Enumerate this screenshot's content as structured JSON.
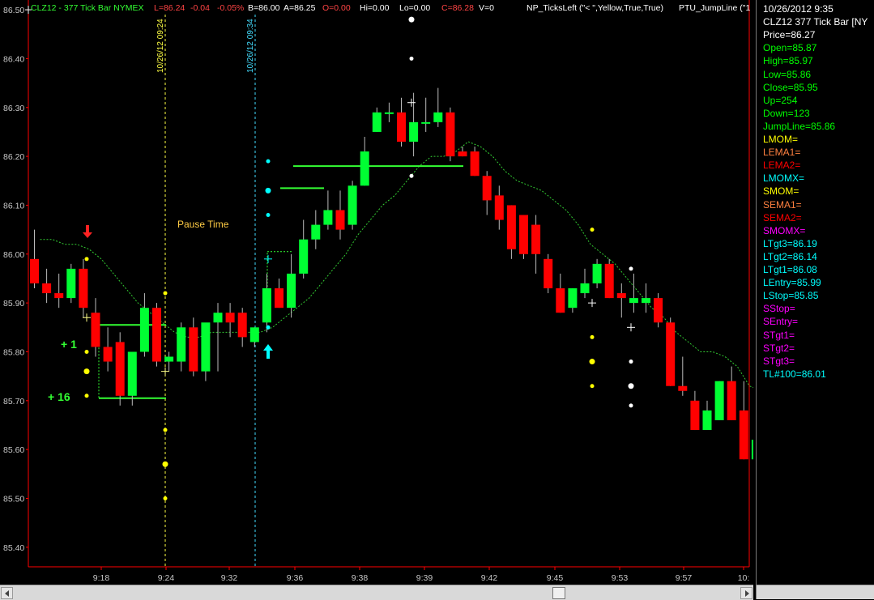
{
  "header": {
    "symbol": "CLZ12 - 377 Tick Bar  NYMEX",
    "last": "L=86.24",
    "change": "-0.04",
    "pct": "-0.05%",
    "bid": "B=86.00",
    "ask": "A=86.25",
    "open": "O=0.00",
    "hi": "Hi=0.00",
    "lo": "Lo=0.00",
    "close": "C=86.28",
    "volume": "V=0",
    "indicator1": "NP_TicksLeft (\"< \",Yellow,True,True)",
    "indicator2": "PTU_JumpLine (\"1"
  },
  "colors": {
    "up": "#00ff33",
    "down": "#ff0000",
    "axis": "#ff0000",
    "label_green": "#00ff00",
    "label_yellow": "#ffff00",
    "label_cyan": "#00ffff",
    "label_magenta": "#ff00ff",
    "label_orange": "#ff8040",
    "label_white": "#ffffff",
    "pause_text": "#ffcc44"
  },
  "annotations": {
    "pause_time": "Pause Time",
    "plus_one": "+ 1",
    "plus_sixteen": "+ 16",
    "vline1_label": "10/26/12 09:24",
    "vline2_label": "10/26/12 09:34"
  },
  "chart_data": {
    "type": "candlestick",
    "ylim": [
      85.36,
      86.52
    ],
    "yticks": [
      "86.50",
      "86.40",
      "86.30",
      "86.20",
      "86.10",
      "86.00",
      "85.90",
      "85.80",
      "85.70",
      "85.60",
      "85.50",
      "85.40"
    ],
    "xticks": [
      "9:18",
      "9:24",
      "9:32",
      "9:36",
      "9:38",
      "9:39",
      "9:42",
      "9:45",
      "9:53",
      "9:57",
      "10:"
    ],
    "candles": [
      {
        "o": 85.99,
        "h": 86.05,
        "l": 85.93,
        "c": 85.94
      },
      {
        "o": 85.94,
        "h": 85.97,
        "l": 85.9,
        "c": 85.92
      },
      {
        "o": 85.92,
        "h": 85.96,
        "l": 85.89,
        "c": 85.91
      },
      {
        "o": 85.91,
        "h": 85.98,
        "l": 85.9,
        "c": 85.97
      },
      {
        "o": 85.97,
        "h": 85.99,
        "l": 85.87,
        "c": 85.89
      },
      {
        "o": 85.88,
        "h": 85.91,
        "l": 85.79,
        "c": 85.81
      },
      {
        "o": 85.81,
        "h": 85.85,
        "l": 85.76,
        "c": 85.78
      },
      {
        "o": 85.82,
        "h": 85.84,
        "l": 85.69,
        "c": 85.71
      },
      {
        "o": 85.71,
        "h": 85.8,
        "l": 85.69,
        "c": 85.8
      },
      {
        "o": 85.8,
        "h": 85.92,
        "l": 85.79,
        "c": 85.89
      },
      {
        "o": 85.89,
        "h": 85.9,
        "l": 85.77,
        "c": 85.78
      },
      {
        "o": 85.78,
        "h": 85.8,
        "l": 85.76,
        "c": 85.79
      },
      {
        "o": 85.78,
        "h": 85.86,
        "l": 85.76,
        "c": 85.85
      },
      {
        "o": 85.85,
        "h": 85.87,
        "l": 85.75,
        "c": 85.76
      },
      {
        "o": 85.76,
        "h": 85.84,
        "l": 85.74,
        "c": 85.86
      },
      {
        "o": 85.86,
        "h": 85.9,
        "l": 85.76,
        "c": 85.88
      },
      {
        "o": 85.88,
        "h": 85.9,
        "l": 85.83,
        "c": 85.86
      },
      {
        "o": 85.88,
        "h": 85.89,
        "l": 85.81,
        "c": 85.83
      },
      {
        "o": 85.82,
        "h": 85.85,
        "l": 85.81,
        "c": 85.85
      },
      {
        "o": 85.86,
        "h": 85.96,
        "l": 85.84,
        "c": 85.93
      },
      {
        "o": 85.93,
        "h": 85.95,
        "l": 85.89,
        "c": 85.89
      },
      {
        "o": 85.89,
        "h": 86.0,
        "l": 85.87,
        "c": 85.96
      },
      {
        "o": 85.96,
        "h": 86.07,
        "l": 85.95,
        "c": 86.03
      },
      {
        "o": 86.03,
        "h": 86.09,
        "l": 86.01,
        "c": 86.06
      },
      {
        "o": 86.06,
        "h": 86.13,
        "l": 86.05,
        "c": 86.09
      },
      {
        "o": 86.09,
        "h": 86.13,
        "l": 86.03,
        "c": 86.05
      },
      {
        "o": 86.06,
        "h": 86.15,
        "l": 86.05,
        "c": 86.14
      },
      {
        "o": 86.14,
        "h": 86.24,
        "l": 86.14,
        "c": 86.21
      },
      {
        "o": 86.25,
        "h": 86.3,
        "l": 86.25,
        "c": 86.29
      },
      {
        "o": 86.29,
        "h": 86.31,
        "l": 86.27,
        "c": 86.29
      },
      {
        "o": 86.29,
        "h": 86.32,
        "l": 86.22,
        "c": 86.23
      },
      {
        "o": 86.23,
        "h": 86.33,
        "l": 86.2,
        "c": 86.27
      },
      {
        "o": 86.27,
        "h": 86.32,
        "l": 86.25,
        "c": 86.27
      },
      {
        "o": 86.27,
        "h": 86.34,
        "l": 86.26,
        "c": 86.29
      },
      {
        "o": 86.29,
        "h": 86.3,
        "l": 86.19,
        "c": 86.2
      },
      {
        "o": 86.21,
        "h": 86.22,
        "l": 86.2,
        "c": 86.2
      },
      {
        "o": 86.21,
        "h": 86.22,
        "l": 86.16,
        "c": 86.16
      },
      {
        "o": 86.16,
        "h": 86.17,
        "l": 86.08,
        "c": 86.11
      },
      {
        "o": 86.12,
        "h": 86.14,
        "l": 86.05,
        "c": 86.07
      },
      {
        "o": 86.1,
        "h": 86.1,
        "l": 85.99,
        "c": 86.01
      },
      {
        "o": 86.08,
        "h": 86.08,
        "l": 85.99,
        "c": 86.0
      },
      {
        "o": 86.06,
        "h": 86.08,
        "l": 85.96,
        "c": 86.0
      },
      {
        "o": 85.99,
        "h": 86.0,
        "l": 85.92,
        "c": 85.93
      },
      {
        "o": 85.93,
        "h": 85.96,
        "l": 85.88,
        "c": 85.88
      },
      {
        "o": 85.89,
        "h": 85.93,
        "l": 85.88,
        "c": 85.93
      },
      {
        "o": 85.92,
        "h": 85.97,
        "l": 85.91,
        "c": 85.94
      },
      {
        "o": 85.94,
        "h": 85.99,
        "l": 85.93,
        "c": 85.98
      },
      {
        "o": 85.98,
        "h": 85.99,
        "l": 85.91,
        "c": 85.91
      },
      {
        "o": 85.92,
        "h": 85.94,
        "l": 85.87,
        "c": 85.91
      },
      {
        "o": 85.9,
        "h": 85.96,
        "l": 85.88,
        "c": 85.91
      },
      {
        "o": 85.9,
        "h": 85.94,
        "l": 85.88,
        "c": 85.91
      },
      {
        "o": 85.91,
        "h": 85.92,
        "l": 85.85,
        "c": 85.86
      },
      {
        "o": 85.86,
        "h": 85.87,
        "l": 85.73,
        "c": 85.73
      },
      {
        "o": 85.73,
        "h": 85.79,
        "l": 85.71,
        "c": 85.72
      },
      {
        "o": 85.7,
        "h": 85.72,
        "l": 85.64,
        "c": 85.64
      },
      {
        "o": 85.64,
        "h": 85.7,
        "l": 85.64,
        "c": 85.68
      },
      {
        "o": 85.66,
        "h": 85.74,
        "l": 85.66,
        "c": 85.74
      },
      {
        "o": 85.74,
        "h": 85.77,
        "l": 85.66,
        "c": 85.66
      },
      {
        "o": 85.68,
        "h": 85.74,
        "l": 85.58,
        "c": 85.58
      },
      {
        "o": 85.58,
        "h": 85.62,
        "l": 85.55,
        "c": 85.62
      }
    ],
    "jump_line": [
      86.03,
      86.03,
      86.02,
      86.02,
      86.01,
      85.99,
      85.96,
      85.93,
      85.9,
      85.88,
      85.86,
      85.84,
      85.83,
      85.83,
      85.84,
      85.84,
      85.84,
      85.84,
      85.84,
      85.85,
      85.87,
      85.89,
      85.91,
      85.94,
      85.97,
      86.0,
      86.04,
      86.07,
      86.1,
      86.12,
      86.15,
      86.18,
      86.2,
      86.2,
      86.21,
      86.23,
      86.22,
      86.2,
      86.17,
      86.15,
      86.14,
      86.13,
      86.11,
      86.09,
      86.06,
      86.02,
      86.0,
      85.98,
      85.95,
      85.92,
      85.89,
      85.87,
      85.84,
      85.82,
      85.8,
      85.8,
      85.79,
      85.77,
      85.73,
      85.72
    ]
  },
  "side_panel": [
    {
      "text": "10/26/2012  9:35",
      "color": "#ffffff"
    },
    {
      "text": "CLZ12 377 Tick Bar [NY",
      "color": "#ffffff"
    },
    {
      "text": "Price=86.27",
      "color": "#ffffff"
    },
    {
      "text": "Open=85.87",
      "color": "#00ff00"
    },
    {
      "text": "High=85.97",
      "color": "#00ff00"
    },
    {
      "text": "Low=85.86",
      "color": "#00ff00"
    },
    {
      "text": "Close=85.95",
      "color": "#00ff00"
    },
    {
      "text": "Up=254",
      "color": "#00ff00"
    },
    {
      "text": "Down=123",
      "color": "#00ff00"
    },
    {
      "text": "JumpLine=85.86",
      "color": "#00ff00"
    },
    {
      "text": "LMOM=",
      "color": "#ffff00"
    },
    {
      "text": "LEMA1=",
      "color": "#ff8040"
    },
    {
      "text": "LEMA2=",
      "color": "#ff0000"
    },
    {
      "text": "LMOMX=",
      "color": "#00ffff"
    },
    {
      "text": "SMOM=",
      "color": "#ffff00"
    },
    {
      "text": "SEMA1=",
      "color": "#ff8040"
    },
    {
      "text": "SEMA2=",
      "color": "#ff0000"
    },
    {
      "text": "SMOMX=",
      "color": "#ff00ff"
    },
    {
      "text": "LTgt3=86.19",
      "color": "#00ffff"
    },
    {
      "text": "LTgt2=86.14",
      "color": "#00ffff"
    },
    {
      "text": "LTgt1=86.08",
      "color": "#00ffff"
    },
    {
      "text": "LEntry=85.99",
      "color": "#00ffff"
    },
    {
      "text": "LStop=85.85",
      "color": "#00ffff"
    },
    {
      "text": "SStop=",
      "color": "#ff00ff"
    },
    {
      "text": "SEntry=",
      "color": "#ff00ff"
    },
    {
      "text": "STgt1=",
      "color": "#ff00ff"
    },
    {
      "text": "STgt2=",
      "color": "#ff00ff"
    },
    {
      "text": "STgt3=",
      "color": "#ff00ff"
    },
    {
      "text": "TL#100=86.01",
      "color": "#00ffff"
    }
  ]
}
